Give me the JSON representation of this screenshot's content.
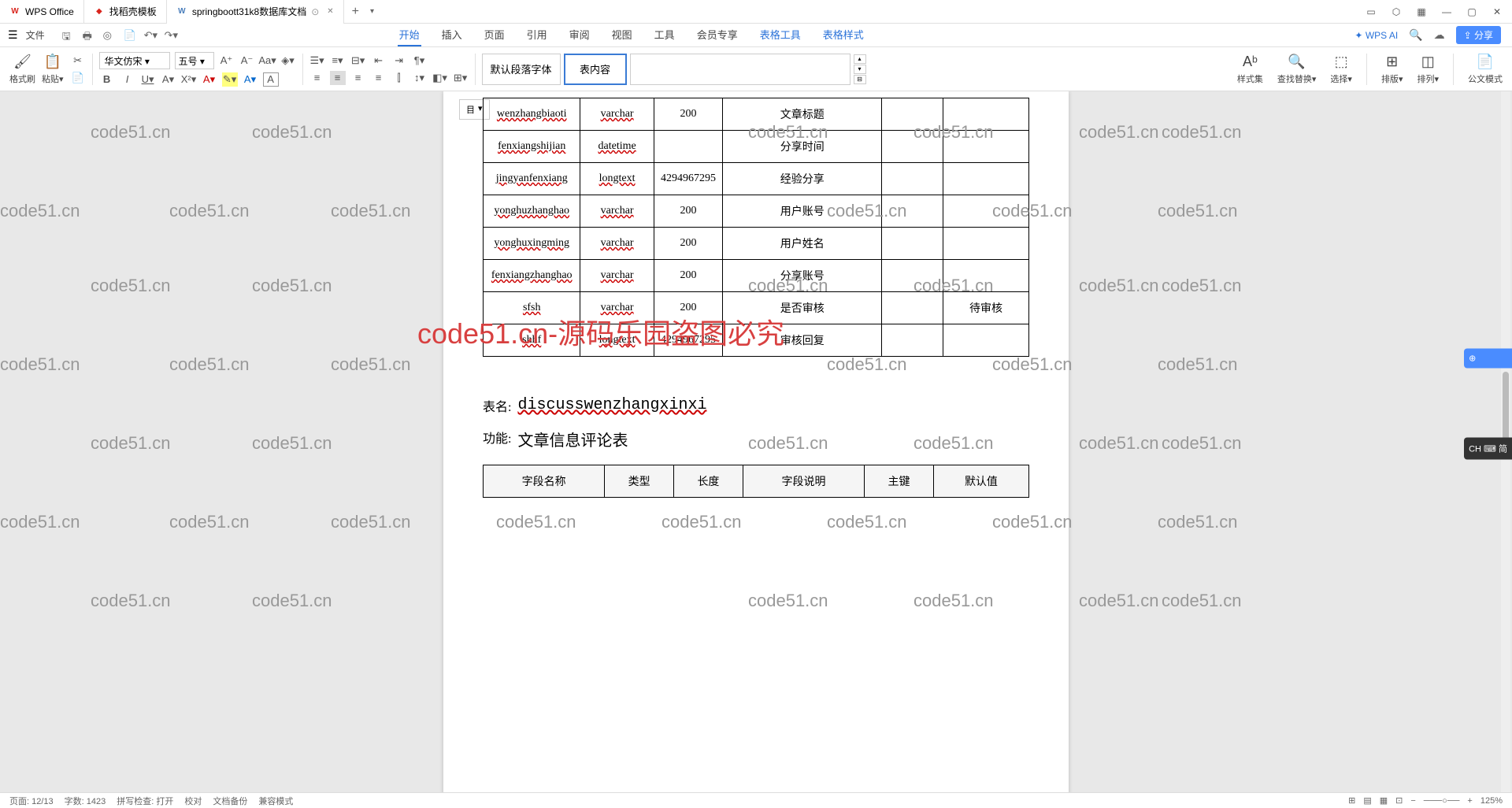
{
  "titlebar": {
    "tabs": [
      {
        "icon": "W",
        "label": "WPS Office"
      },
      {
        "icon": "D",
        "label": "找稻壳模板"
      },
      {
        "icon": "W",
        "label": "springboott31k8数据库文档"
      }
    ],
    "new_tab": "+"
  },
  "menubar": {
    "file": "文件",
    "tabs": [
      "开始",
      "插入",
      "页面",
      "引用",
      "审阅",
      "视图",
      "工具",
      "会员专享",
      "表格工具",
      "表格样式"
    ],
    "active_tab": 0,
    "wps_ai": "WPS AI",
    "share": "分享"
  },
  "ribbon": {
    "format_painter": "格式刷",
    "paste": "粘贴",
    "font": "华文仿宋",
    "size": "五号",
    "style1": "默认段落字体",
    "style2": "表内容",
    "style_set": "样式集",
    "find_replace": "查找替换",
    "select": "选择",
    "layout": "排版",
    "arrange": "排列",
    "official_mode": "公文模式"
  },
  "nav_floater": "目",
  "table1": {
    "rows": [
      {
        "field": "wenzhangbiaoti",
        "type": "varchar",
        "len": "200",
        "desc": "文章标题",
        "pk": "",
        "default": ""
      },
      {
        "field": "fenxiangshijian",
        "type": "datetime",
        "len": "",
        "desc": "分享时间",
        "pk": "",
        "default": ""
      },
      {
        "field": "jingyanfenxiang",
        "type": "longtext",
        "len": "4294967295",
        "desc": "经验分享",
        "pk": "",
        "default": ""
      },
      {
        "field": "yonghuzhanghao",
        "type": "varchar",
        "len": "200",
        "desc": "用户账号",
        "pk": "",
        "default": ""
      },
      {
        "field": "yonghuxingming",
        "type": "varchar",
        "len": "200",
        "desc": "用户姓名",
        "pk": "",
        "default": ""
      },
      {
        "field": "fenxiangzhanghao",
        "type": "varchar",
        "len": "200",
        "desc": "分享账号",
        "pk": "",
        "default": ""
      },
      {
        "field": "sfsh",
        "type": "varchar",
        "len": "200",
        "desc": "是否审核",
        "pk": "",
        "default": "待审核"
      },
      {
        "field": "shhf",
        "type": "longtext",
        "len": "4294967295",
        "desc": "审核回复",
        "pk": "",
        "default": ""
      }
    ]
  },
  "section2": {
    "table_name_label": "表名:",
    "table_name": "discusswenzhangxinxi",
    "func_label": "功能:",
    "func_value": "文章信息评论表"
  },
  "table2_headers": [
    "字段名称",
    "类型",
    "长度",
    "字段说明",
    "主键",
    "默认值"
  ],
  "statusbar": {
    "page": "页面: 12/13",
    "words": "字数: 1423",
    "spell": "拼写检查: 打开",
    "proof": "校对",
    "backup": "文档备份",
    "mode": "兼容模式",
    "zoom": "125%"
  },
  "side": {
    "ai": "⊕",
    "ime": "CH ⌨ 简"
  },
  "watermark": "code51.cn",
  "watermark_center": "code51.cn-源码乐园盗图必究"
}
